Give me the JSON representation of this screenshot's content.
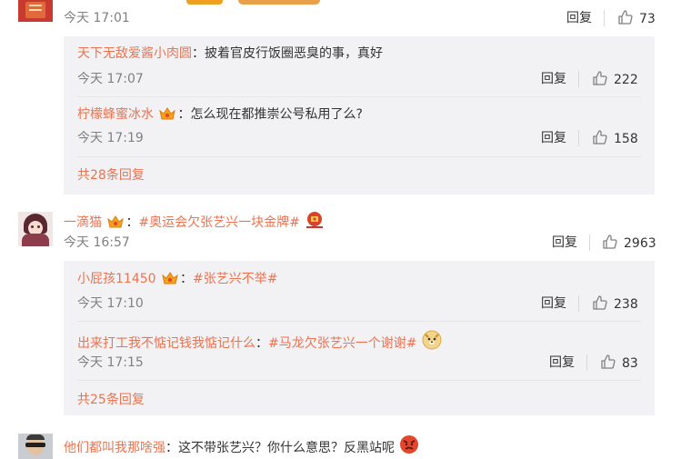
{
  "top_comment": {
    "time": "今天 17:01",
    "reply_label": "回复",
    "likes": "73",
    "subreplies": [
      {
        "user": "天下无敌爱酱小肉圆",
        "sep": "：",
        "text": "披着官皮行饭圈恶臭的事，真好",
        "time": "今天 17:07",
        "reply_label": "回复",
        "likes": "222"
      },
      {
        "user": "柠檬蜂蜜冰水",
        "sep": "：",
        "text": "怎么现在都推崇公号私用了么?",
        "time": "今天 17:19",
        "reply_label": "回复",
        "likes": "158"
      }
    ],
    "more_label": "共28条回复"
  },
  "comment2": {
    "user": "一滴猫",
    "sep": "：",
    "topic": "#奥运会欠张艺兴一块金牌#",
    "time": "今天 16:57",
    "reply_label": "回复",
    "likes": "2963",
    "subreplies": [
      {
        "user": "小屁孩11450",
        "sep": "：",
        "topic": "#张艺兴不举#",
        "time": "今天 17:10",
        "reply_label": "回复",
        "likes": "238"
      },
      {
        "user": "出来打工我不惦记钱我惦记什么",
        "sep": "：",
        "topic": "#马龙欠张艺兴一个谢谢#",
        "time": "今天 17:15",
        "reply_label": "回复",
        "likes": "83"
      }
    ],
    "more_label": "共25条回复"
  },
  "comment3": {
    "user": "他们都叫我那啥强",
    "sep": "：",
    "text": "这不带张艺兴？你什么意思？反黑站呢"
  },
  "colors": {
    "accent": "#eb7350",
    "reply_box": "#f2f2f5",
    "meta": "#808080"
  },
  "icons": [
    "thumbs-up-icon",
    "vip-crown-icon",
    "angry-face-icon",
    "doge-emoji-icon",
    "red-envelope-emoji-icon"
  ]
}
